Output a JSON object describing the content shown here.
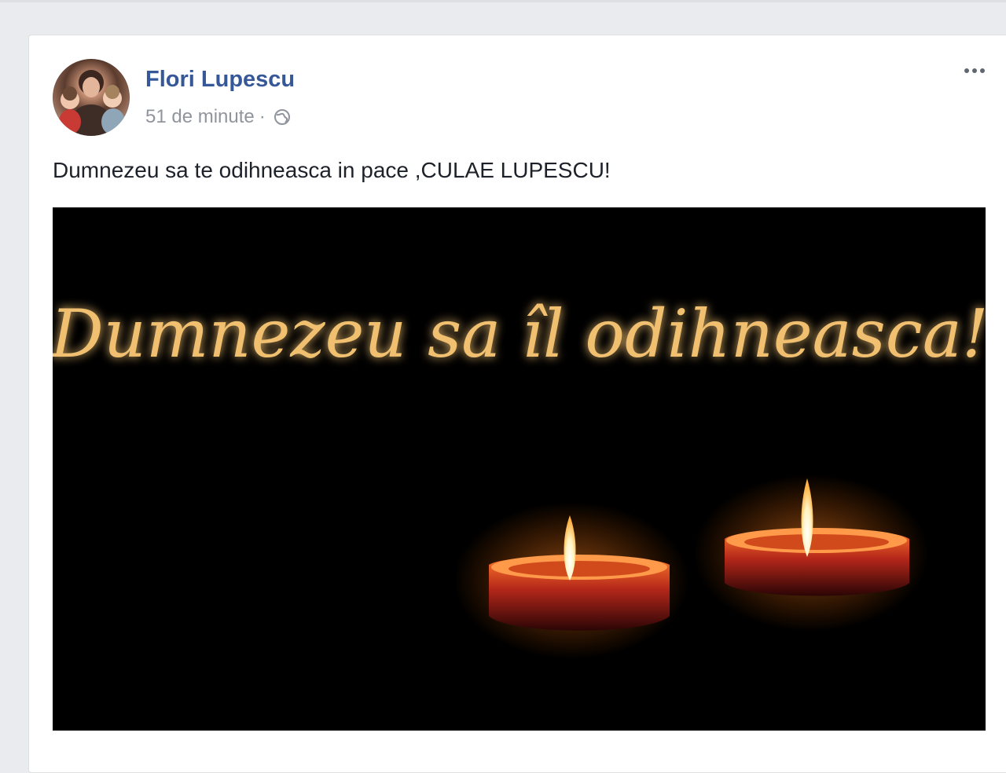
{
  "post": {
    "author": {
      "name": "Flori Lupescu",
      "avatar_icon": "profile-photo"
    },
    "timestamp": "51 de minute",
    "separator": "·",
    "privacy_icon": "globe-icon",
    "more_icon": "more-options-icon",
    "text": "Dumnezeu sa te odihneasca in pace ,CULAE LUPESCU!",
    "image": {
      "caption_text": "Dumnezeu sa îl odihneasca!",
      "content": "two-candles",
      "text_color": "#f0c070",
      "background": "#000000"
    }
  },
  "colors": {
    "page_background": "#e9ebee",
    "author_link": "#365899",
    "meta_text": "#90949c",
    "body_text": "#1d2129"
  }
}
